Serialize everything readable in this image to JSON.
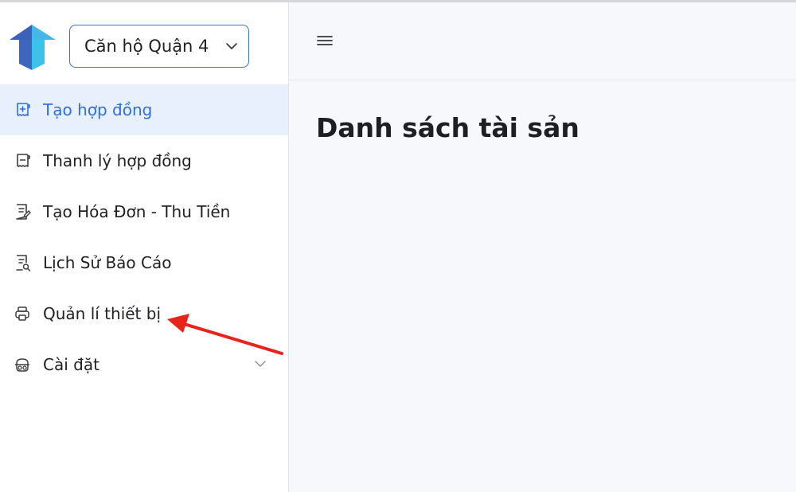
{
  "project_selector": {
    "value": "Căn hộ Quận 4"
  },
  "sidebar": {
    "items": [
      {
        "label": "Tạo hợp đồng",
        "icon": "contract-add-icon",
        "active": true
      },
      {
        "label": "Thanh lý hợp đồng",
        "icon": "contract-remove-icon"
      },
      {
        "label": "Tạo Hóa Đơn - Thu Tiền",
        "icon": "invoice-edit-icon"
      },
      {
        "label": "Lịch Sử Báo Cáo",
        "icon": "report-search-icon"
      },
      {
        "label": "Quản lí thiết bị",
        "icon": "printer-icon"
      },
      {
        "label": "Cài đặt",
        "icon": "settings-icon",
        "expandable": true
      }
    ]
  },
  "main": {
    "title": "Danh sách tài sản"
  },
  "colors": {
    "accent": "#2f6fe0",
    "active_bg": "#e9f0fd",
    "annotation_arrow": "#e8231a",
    "main_bg": "#f7f8fb"
  }
}
